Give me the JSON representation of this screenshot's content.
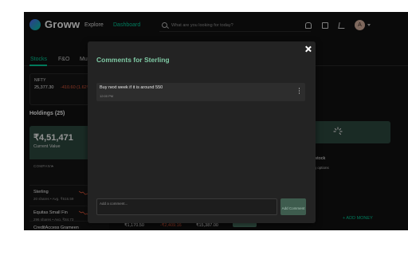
{
  "topnav": {
    "brand": "Groww",
    "links": [
      "Explore",
      "Dashboard",
      "Mut"
    ],
    "active_link": "Dashboard",
    "search_placeholder": "What are you looking for today?",
    "avatar_initial": "A",
    "icons": [
      "bell-icon",
      "wallet-icon",
      "cart-icon"
    ]
  },
  "subtabs": {
    "items": [
      "Stocks",
      "F&O",
      "Mut"
    ],
    "active": "Stocks"
  },
  "index": {
    "name": "NIFTY",
    "price": "25,377.30",
    "change": "-410.60 (1.62%)"
  },
  "holdings": {
    "title": "Holdings (25)",
    "current_value": "₹4,51,471",
    "current_value_label": "Current Value",
    "column_header": "COMPANY",
    "rows": [
      {
        "name": "Sterling",
        "sub": "20 shares • Avg. ₹616.59"
      },
      {
        "name": "Equitas Small Fin",
        "sub": "296 shares • Avg. ₹84.73"
      },
      {
        "name": "CreditAccess Grameen",
        "sub": ""
      }
    ]
  },
  "right_panel": {
    "stack_text": "ct a stock",
    "options_text": "esting options",
    "add_money": "+ ADD MONEY"
  },
  "bottom_row": {
    "values": [
      "₹1,170.50",
      "-₹2,409.16",
      "₹15,387.00"
    ]
  },
  "comments_button": "Comments",
  "modal": {
    "title": "Comments for Sterling",
    "comments": [
      {
        "text": "Buy next week if it is around 550",
        "time": "12:00 PM"
      }
    ],
    "input_placeholder": "Add a comment...",
    "add_button": "Add Comment"
  },
  "colors": {
    "accent": "#00d09c",
    "modal_title": "#7fc9a4",
    "negative": "#eb5b3c",
    "card_green": "#2e4a40"
  }
}
